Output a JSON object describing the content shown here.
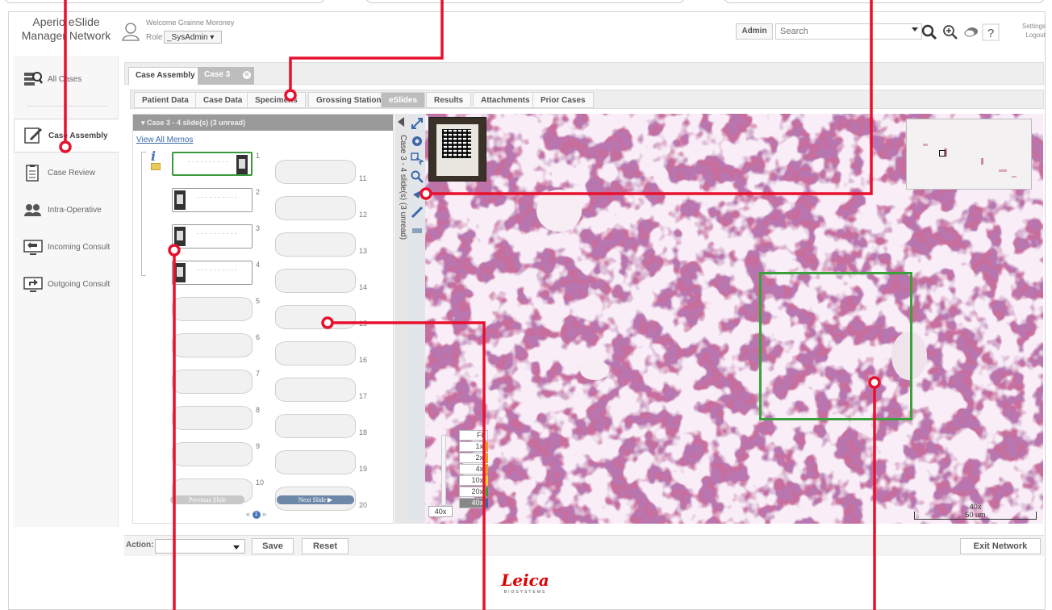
{
  "header": {
    "app_title": "Aperio eSlide Manager Network",
    "welcome": "Welcome Grainne Moroney",
    "role_label": "Role",
    "role_value": "_SysAdmin",
    "admin_button": "Admin",
    "search_placeholder": "Search",
    "help_label": "?",
    "settings_link": "Settings",
    "logout_link": "Logout"
  },
  "sidebar": {
    "items": [
      {
        "label": "All Cases",
        "icon": "all-cases-icon"
      },
      {
        "label": "Case Assembly",
        "icon": "case-assembly-icon"
      },
      {
        "label": "Case Review",
        "icon": "case-review-icon"
      },
      {
        "label": "Intra-Operative",
        "icon": "intra-operative-icon"
      },
      {
        "label": "Incoming Consult",
        "icon": "incoming-consult-icon"
      },
      {
        "label": "Outgoing Consult",
        "icon": "outgoing-consult-icon"
      }
    ],
    "selected": "Case Assembly"
  },
  "case_tabs": [
    {
      "label": "Case Assembly"
    },
    {
      "label": "Case 3"
    }
  ],
  "section_tabs": [
    {
      "label": "Patient Data"
    },
    {
      "label": "Case Data"
    },
    {
      "label": "Specimens"
    },
    {
      "label": "Grossing Station"
    },
    {
      "label": "eSlides"
    },
    {
      "label": "Results"
    },
    {
      "label": "Attachments"
    },
    {
      "label": "Prior Cases"
    }
  ],
  "selected_section_tab": "eSlides",
  "slides_panel": {
    "header": "Case 3 - 4 slide(s) (3 unread)",
    "memos_link": "View All Memos",
    "vertical_label": "Case 3 - 4 slide(s) (3 unread)",
    "slot_numbers": [
      "1",
      "2",
      "3",
      "4",
      "5",
      "6",
      "7",
      "8",
      "9",
      "10",
      "11",
      "12",
      "13",
      "14",
      "15",
      "16",
      "17",
      "18",
      "19",
      "20"
    ],
    "previous_button": "Previous Slide",
    "next_button": "Next Slide",
    "pager_current": "1"
  },
  "viewer": {
    "zoom_levels": [
      "Fit",
      "1x",
      "2x",
      "4x",
      "10x",
      "20x",
      "40x"
    ],
    "current_zoom": "40x",
    "scale_magnification": "40x",
    "scale_length": "50 um"
  },
  "footer": {
    "action_label": "Action:",
    "save_button": "Save",
    "reset_button": "Reset",
    "exit_button": "Exit Network"
  },
  "logo": {
    "brand": "Leica",
    "sub": "BIOSYSTEMS"
  },
  "colors": {
    "callout": "#e8112d",
    "roi": "#3aa03a",
    "link": "#3a67a8",
    "brand": "#dd0000"
  }
}
